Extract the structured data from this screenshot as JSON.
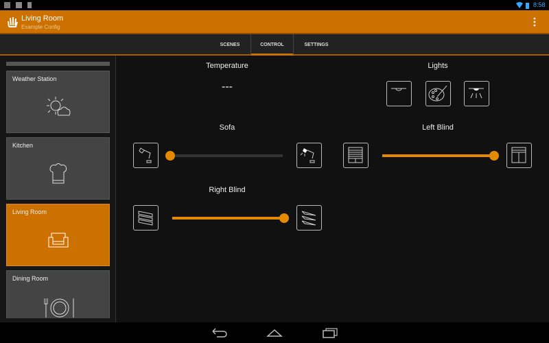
{
  "status_bar": {
    "time": "8:58",
    "icons": [
      "hand-icon",
      "clipboard-icon",
      "play-store-icon",
      "wifi-icon",
      "battery-icon"
    ]
  },
  "action_bar": {
    "title": "Living Room",
    "subtitle": "Example Config",
    "menu_icon": "overflow-menu-icon"
  },
  "tabs": [
    {
      "label": "SCENES",
      "active": false
    },
    {
      "label": "CONTROL",
      "active": true
    },
    {
      "label": "SETTINGS",
      "active": false
    }
  ],
  "sidebar": {
    "items": [
      {
        "label": "Weather Station",
        "icon": "weather-icon"
      },
      {
        "label": "Kitchen",
        "icon": "chef-hat-icon"
      },
      {
        "label": "Living Room",
        "icon": "armchair-icon",
        "active": true
      },
      {
        "label": "Dining Room",
        "icon": "plate-cutlery-icon"
      }
    ]
  },
  "controls": {
    "temperature": {
      "label": "Temperature",
      "value": "---"
    },
    "lights": {
      "label": "Lights"
    },
    "sofa": {
      "label": "Sofa",
      "value_percent": 0
    },
    "left_blind": {
      "label": "Left Blind",
      "value_percent": 100
    },
    "right_blind": {
      "label": "Right Blind",
      "value_percent": 100
    }
  },
  "colors": {
    "accent": "#cc7000",
    "slider": "#e58a00"
  }
}
